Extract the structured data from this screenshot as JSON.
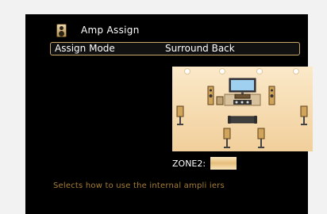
{
  "header": {
    "title": "Amp Assign",
    "icon": "speaker-icon"
  },
  "setting": {
    "label": "Assign Mode",
    "value": "Surround Back"
  },
  "zone": {
    "label": "ZONE2:"
  },
  "description": "Selects how to use the internal ampli iers",
  "colors": {
    "background": "#000000",
    "accent_gold": "#c9a86a",
    "description_text": "#a57d35",
    "room_floor": "#f3d6a6"
  }
}
